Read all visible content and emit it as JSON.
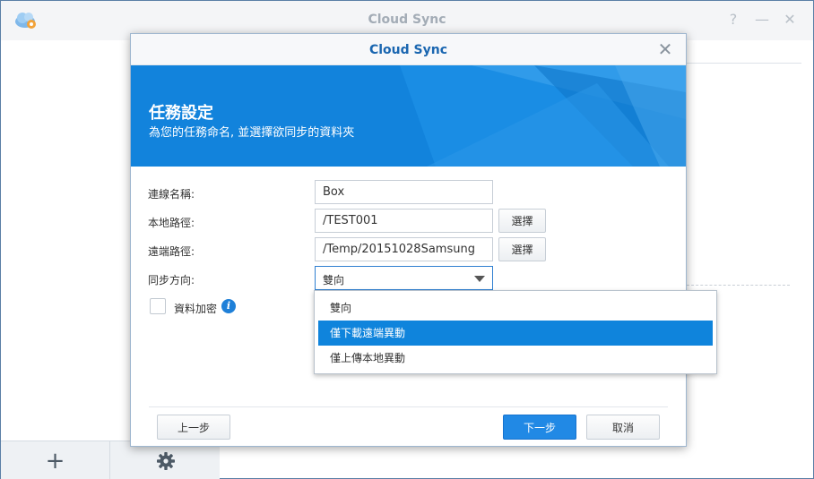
{
  "app": {
    "title": "Cloud Sync",
    "help_glyph": "?",
    "minimize_glyph": "—",
    "close_glyph": "✕",
    "bottom_add_glyph": "+",
    "bottom_settings_glyph": "⚙"
  },
  "dialog": {
    "title": "Cloud Sync",
    "close_glyph": "✕",
    "banner": {
      "title": "任務設定",
      "subtitle": "為您的任務命名, 並選擇欲同步的資料夾",
      "color": "#1283dc"
    },
    "form": {
      "connection_name_label": "連線名稱:",
      "connection_name_value": "Box",
      "local_path_label": "本地路徑:",
      "local_path_value": "/TEST001",
      "remote_path_label": "遠端路徑:",
      "remote_path_value": "/Temp/20151028Samsung",
      "select_button_label": "選擇",
      "sync_direction_label": "同步方向:",
      "sync_direction_value": "雙向",
      "encrypt_label": "資料加密",
      "encrypt_checked": false
    },
    "dropdown": {
      "options": [
        {
          "label": "雙向",
          "selected": false
        },
        {
          "label": "僅下載遠端異動",
          "selected": true
        },
        {
          "label": "僅上傳本地異動",
          "selected": false
        }
      ],
      "highlight_color": "#0f84dc"
    },
    "footer": {
      "prev_label": "上一步",
      "next_label": "下一步",
      "cancel_label": "取消"
    }
  }
}
